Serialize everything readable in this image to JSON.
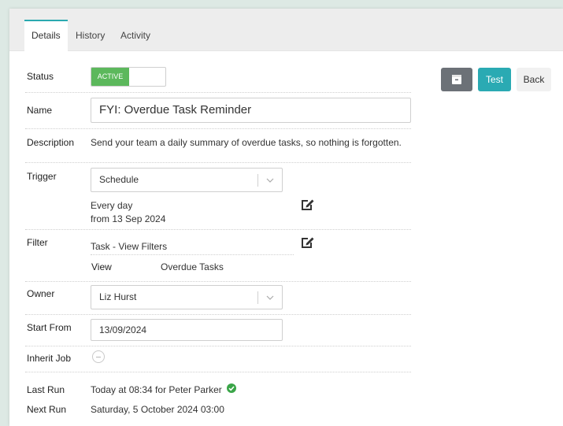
{
  "tabs": [
    {
      "label": "Details",
      "active": true
    },
    {
      "label": "History",
      "active": false
    },
    {
      "label": "Activity",
      "active": false
    }
  ],
  "fields": {
    "status": {
      "label": "Status",
      "value": "ACTIVE"
    },
    "name": {
      "label": "Name",
      "value": "FYI: Overdue Task Reminder"
    },
    "description": {
      "label": "Description",
      "value": "Send your team a daily summary of overdue tasks, so nothing is forgotten."
    },
    "trigger": {
      "label": "Trigger",
      "value": "Schedule",
      "line1": "Every day",
      "line2": "from 13 Sep 2024"
    },
    "filter": {
      "label": "Filter",
      "value": "Task - View Filters",
      "view_label": "View",
      "view_value": "Overdue Tasks"
    },
    "owner": {
      "label": "Owner",
      "value": "Liz Hurst"
    },
    "start_from": {
      "label": "Start From",
      "value": "13/09/2024"
    },
    "inherit_job": {
      "label": "Inherit Job"
    },
    "last_run": {
      "label": "Last Run",
      "value": "Today at 08:34 for Peter Parker"
    },
    "next_run": {
      "label": "Next Run",
      "value": "Saturday, 5 October 2024 03:00"
    }
  },
  "actions": {
    "archive_icon": "archive-box-icon",
    "test_label": "Test",
    "back_label": "Back"
  },
  "colors": {
    "accent": "#2aaab3",
    "active_green": "#5cb85c",
    "archive_button": "#6c7177",
    "success_check": "#3aa548"
  }
}
